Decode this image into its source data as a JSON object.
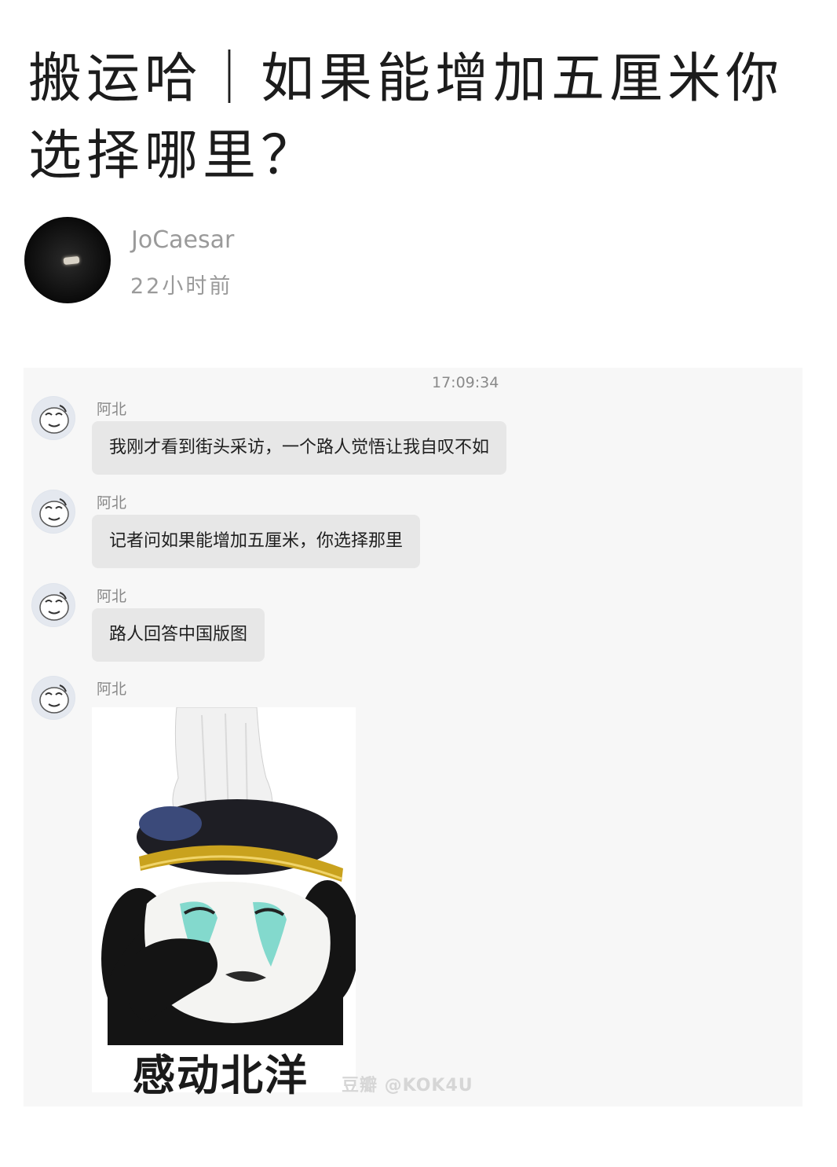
{
  "post": {
    "title": "搬运哈｜如果能增加五厘米你选择哪里？",
    "author": "JoCaesar",
    "time_ago": "22小时前"
  },
  "chat": {
    "timestamp": "17:09:34",
    "messages": [
      {
        "sender": "阿北",
        "text": "我刚才看到街头采访，一个路人觉悟让我自叹不如"
      },
      {
        "sender": "阿北",
        "text": "记者问如果能增加五厘米，你选择那里"
      },
      {
        "sender": "阿北",
        "text": "路人回答中国版图"
      },
      {
        "sender": "阿北",
        "sticker_caption": "感动北洋"
      }
    ],
    "watermark": "豆瓣 @KOK4U"
  },
  "colors": {
    "bubble": "#e7e7e7",
    "chat_background": "#f7f7f7",
    "muted_text": "#9a9a9a"
  },
  "icons": {
    "avatar_sender": "panda-face-avatar",
    "author_avatar": "dark-night-avatar"
  }
}
